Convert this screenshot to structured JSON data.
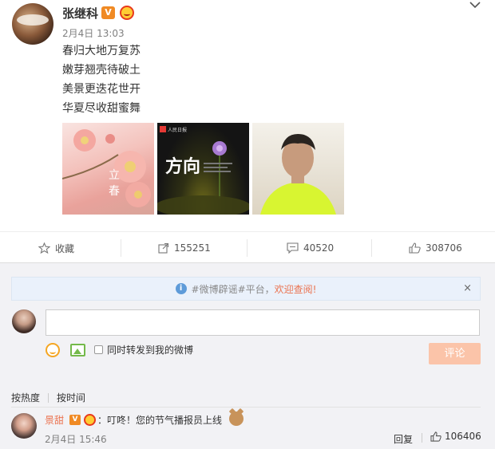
{
  "post": {
    "username": "张继科",
    "verified_badge": "V",
    "timestamp": "2月4日 13:03",
    "lines": [
      "春归大地万复苏",
      "嫩芽翘壳待破土",
      "美景更迭花世开",
      "华夏尽收甜蜜舞"
    ],
    "images": [
      {
        "icon": "plum-blossom-photo",
        "caption_big": "立",
        "caption_small": "春"
      },
      {
        "icon": "flower-poster-photo",
        "caption_big": "方向",
        "tag": "人民日报"
      },
      {
        "icon": "selfie-photo"
      }
    ]
  },
  "actions": {
    "favorite": "收藏",
    "repost": "155251",
    "comment": "40520",
    "like": "308706"
  },
  "notice": {
    "text_a": "#微博辟谣#平台，",
    "text_b": "欢迎查阅!",
    "close": "×"
  },
  "composer": {
    "placeholder": "",
    "sync_label": "同时转发到我的微博",
    "submit_label": "评论"
  },
  "sort": {
    "by_hot": "按热度",
    "by_time": "按时间"
  },
  "comment": {
    "username": "景甜",
    "verified_badge": "V",
    "text": "：叮咚！您的节气播报员上线",
    "timestamp": "2月4日 15:46",
    "reply_label": "回复",
    "likes": "106406"
  },
  "colors": {
    "accent_orange": "#eb7350",
    "badge_orange": "#f08a24",
    "submit_disabled": "#fbc4a9",
    "info_blue": "#5e9bd9"
  }
}
